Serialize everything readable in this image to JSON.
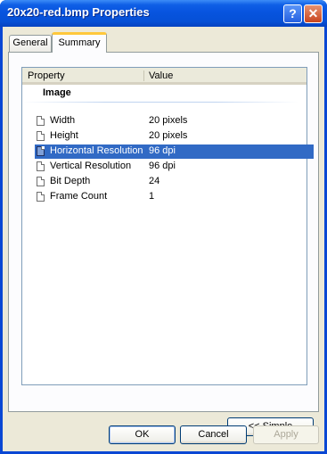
{
  "window": {
    "title": "20x20-red.bmp Properties",
    "help_label": "?",
    "close_label": "✕"
  },
  "tabs": [
    {
      "label": "General"
    },
    {
      "label": "Summary"
    }
  ],
  "list": {
    "headers": {
      "property": "Property",
      "value": "Value"
    },
    "group": "Image",
    "rows": [
      {
        "key": "Width",
        "value": "20 pixels"
      },
      {
        "key": "Height",
        "value": "20 pixels"
      },
      {
        "key": "Horizontal Resolution",
        "value": "96 dpi",
        "selected": true
      },
      {
        "key": "Vertical Resolution",
        "value": "96 dpi"
      },
      {
        "key": "Bit Depth",
        "value": "24"
      },
      {
        "key": "Frame Count",
        "value": "1"
      }
    ]
  },
  "buttons": {
    "simple": "<< Simple",
    "ok": "OK",
    "cancel": "Cancel",
    "apply": "Apply"
  }
}
